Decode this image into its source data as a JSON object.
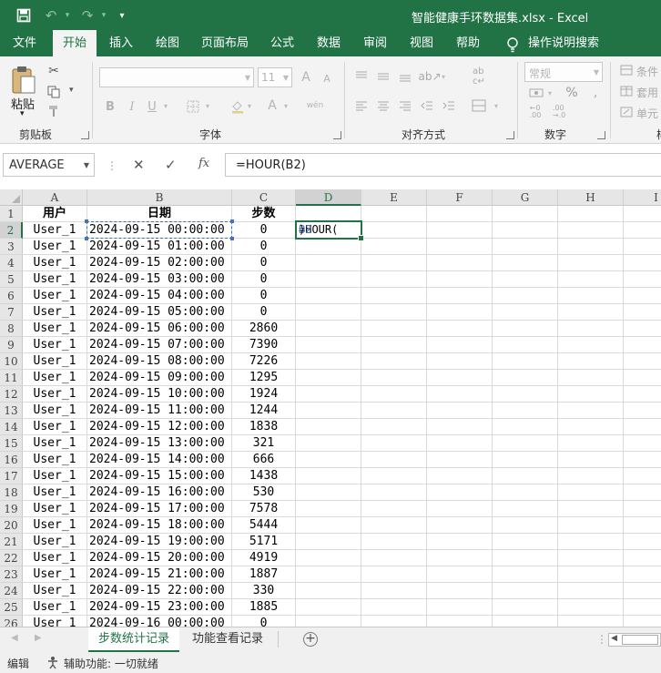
{
  "app": {
    "title": "智能健康手环数据集.xlsx  -  Excel"
  },
  "quick_access": {
    "save_icon": "save-icon",
    "undo_icon": "undo-icon",
    "redo_icon": "redo-icon",
    "customize_icon": "customize-qat-icon"
  },
  "tabs": [
    "文件",
    "开始",
    "插入",
    "绘图",
    "页面布局",
    "公式",
    "数据",
    "审阅",
    "视图",
    "帮助"
  ],
  "active_tab": "开始",
  "tell_me": "操作说明搜索",
  "ribbon": {
    "clipboard": {
      "label": "剪贴板",
      "paste": "粘贴"
    },
    "font": {
      "label": "字体",
      "size": "11",
      "bold": "B",
      "italic": "I",
      "underline": "U",
      "grow": "A",
      "font_color": "A",
      "phonetic": "wén"
    },
    "alignment": {
      "label": "对齐方式"
    },
    "number": {
      "label": "数字",
      "format": "常规",
      "percent": "%"
    },
    "styles": {
      "conditional": "条件",
      "table": "套用",
      "cell": "单元"
    }
  },
  "formula_bar": {
    "name_box": "AVERAGE",
    "formula": "=HOUR(B2)",
    "cancel": "✕",
    "enter": "✓",
    "fx": "fx"
  },
  "columns": [
    "A",
    "B",
    "C",
    "D",
    "E",
    "F",
    "G",
    "H",
    "I"
  ],
  "rows": [
    "1",
    "2",
    "3",
    "4",
    "5",
    "6",
    "7",
    "8",
    "9",
    "10",
    "11",
    "12",
    "13",
    "14",
    "15",
    "16",
    "17",
    "18",
    "19",
    "20",
    "21",
    "22",
    "23",
    "24",
    "25",
    "26"
  ],
  "headers": {
    "a": "用户",
    "b": "日期",
    "c": "步数"
  },
  "data": [
    [
      "User_1",
      "2024-09-15 00:00:00",
      "0"
    ],
    [
      "User_1",
      "2024-09-15 01:00:00",
      "0"
    ],
    [
      "User_1",
      "2024-09-15 02:00:00",
      "0"
    ],
    [
      "User_1",
      "2024-09-15 03:00:00",
      "0"
    ],
    [
      "User_1",
      "2024-09-15 04:00:00",
      "0"
    ],
    [
      "User_1",
      "2024-09-15 05:00:00",
      "0"
    ],
    [
      "User_1",
      "2024-09-15 06:00:00",
      "2860"
    ],
    [
      "User_1",
      "2024-09-15 07:00:00",
      "7390"
    ],
    [
      "User_1",
      "2024-09-15 08:00:00",
      "7226"
    ],
    [
      "User_1",
      "2024-09-15 09:00:00",
      "1295"
    ],
    [
      "User_1",
      "2024-09-15 10:00:00",
      "1924"
    ],
    [
      "User_1",
      "2024-09-15 11:00:00",
      "1244"
    ],
    [
      "User_1",
      "2024-09-15 12:00:00",
      "1838"
    ],
    [
      "User_1",
      "2024-09-15 13:00:00",
      "321"
    ],
    [
      "User_1",
      "2024-09-15 14:00:00",
      "666"
    ],
    [
      "User_1",
      "2024-09-15 15:00:00",
      "1438"
    ],
    [
      "User_1",
      "2024-09-15 16:00:00",
      "530"
    ],
    [
      "User_1",
      "2024-09-15 17:00:00",
      "7578"
    ],
    [
      "User_1",
      "2024-09-15 18:00:00",
      "5444"
    ],
    [
      "User_1",
      "2024-09-15 19:00:00",
      "5171"
    ],
    [
      "User_1",
      "2024-09-15 20:00:00",
      "4919"
    ],
    [
      "User_1",
      "2024-09-15 21:00:00",
      "1887"
    ],
    [
      "User_1",
      "2024-09-15 22:00:00",
      "330"
    ],
    [
      "User_1",
      "2024-09-15 23:00:00",
      "1885"
    ],
    [
      "User_1",
      "2024-09-16 00:00:00",
      "0"
    ]
  ],
  "editing_cell": {
    "prefix": "=HOUR(",
    "ref": "B2",
    "suffix": ")"
  },
  "sheets": [
    "步数统计记录",
    "功能查看记录"
  ],
  "active_sheet": "步数统计记录",
  "status": {
    "mode": "编辑",
    "accessibility": "辅助功能: 一切就绪"
  },
  "colors": {
    "accent": "#217346",
    "ref": "#4472c4"
  }
}
